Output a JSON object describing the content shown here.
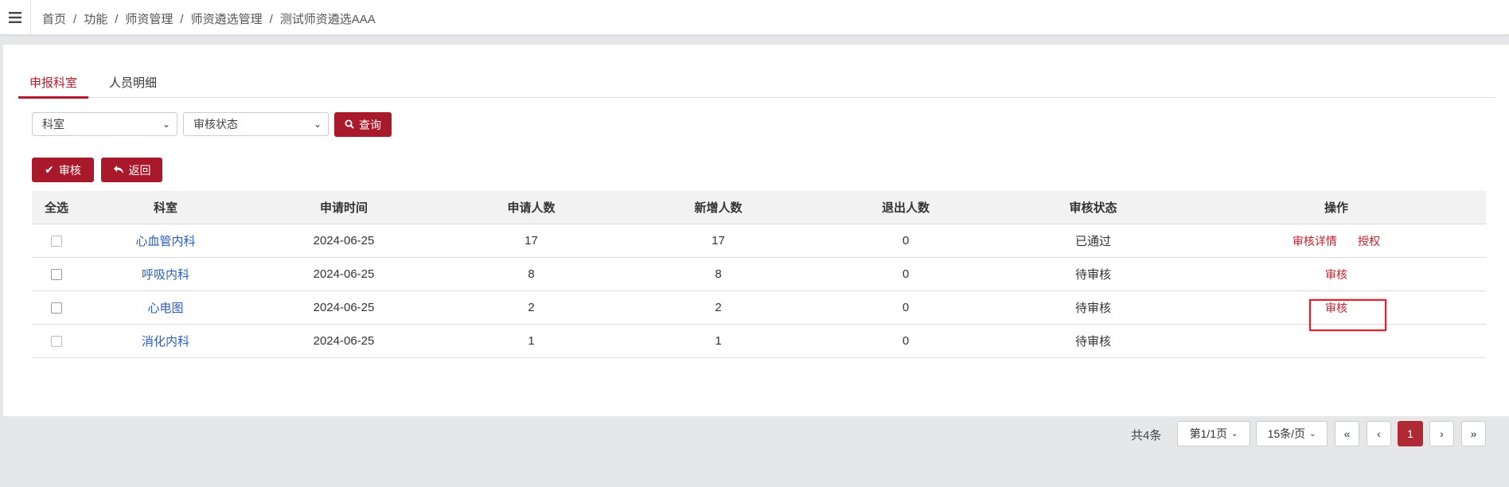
{
  "breadcrumb": {
    "items": [
      "首页",
      "功能",
      "师资管理",
      "师资遴选管理",
      "测试师资遴选AAA"
    ],
    "separator": "/"
  },
  "tabs": [
    {
      "label": "申报科室",
      "active": true
    },
    {
      "label": "人员明细",
      "active": false
    }
  ],
  "filters": {
    "department_select": "科室",
    "status_select": "审核状态",
    "query_label": "查询"
  },
  "toolbar": {
    "audit_label": "审核",
    "back_label": "返回"
  },
  "table": {
    "columns": [
      "全选",
      "科室",
      "申请时间",
      "申请人数",
      "新增人数",
      "退出人数",
      "审核状态",
      "操作"
    ],
    "rows": [
      {
        "dept": "心血管内科",
        "date": "2024-06-25",
        "applicants": "17",
        "added": "17",
        "exited": "0",
        "status": "已通过",
        "ops": [
          "审核详情",
          "授权"
        ]
      },
      {
        "dept": "呼吸内科",
        "date": "2024-06-25",
        "applicants": "8",
        "added": "8",
        "exited": "0",
        "status": "待审核",
        "ops": [
          "审核"
        ]
      },
      {
        "dept": "心电图",
        "date": "2024-06-25",
        "applicants": "2",
        "added": "2",
        "exited": "0",
        "status": "待审核",
        "ops": [
          "审核"
        ]
      },
      {
        "dept": "消化内科",
        "date": "2024-06-25",
        "applicants": "1",
        "added": "1",
        "exited": "0",
        "status": "待审核",
        "ops": []
      }
    ]
  },
  "pagination": {
    "total": "共4条",
    "page_select": "第1/1页",
    "size_select": "15条/页",
    "first": "«",
    "prev": "‹",
    "current": "1",
    "next": "›",
    "last": "»"
  },
  "colors": {
    "primary": "#a8192b",
    "link_blue": "#2a5cb8",
    "link_red": "#c0222f",
    "highlight": "#e0212b"
  }
}
